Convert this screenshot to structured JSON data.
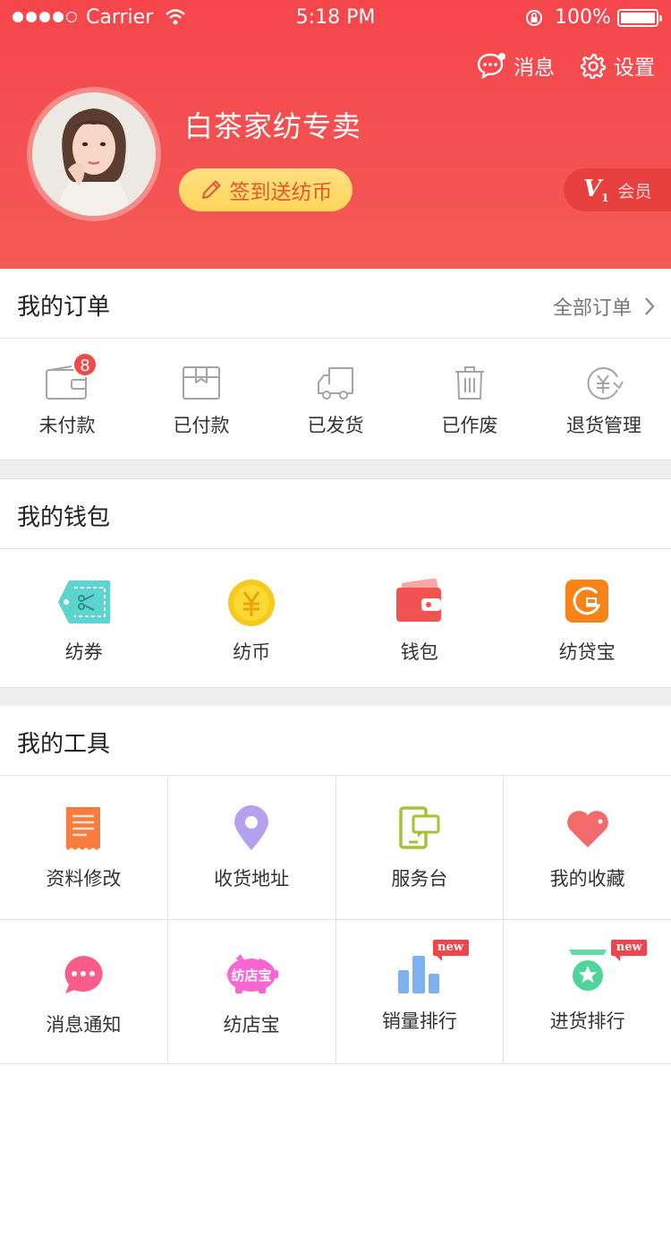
{
  "status_bar": {
    "carrier": "Carrier",
    "time": "5:18 PM",
    "battery": "100%"
  },
  "header": {
    "messages_label": "消息",
    "settings_label": "设置",
    "username": "白茶家纺专卖",
    "signin_label": "签到送纺币",
    "vip_level": "1",
    "vip_label": "会员"
  },
  "orders": {
    "title": "我的订单",
    "all_label": "全部订单",
    "items": [
      {
        "label": "未付款",
        "icon": "wallet-card-icon",
        "badge": "8"
      },
      {
        "label": "已付款",
        "icon": "package-icon"
      },
      {
        "label": "已发货",
        "icon": "truck-icon"
      },
      {
        "label": "已作废",
        "icon": "trash-icon"
      },
      {
        "label": "退货管理",
        "icon": "yen-refund-icon"
      }
    ]
  },
  "wallet": {
    "title": "我的钱包",
    "items": [
      {
        "label": "纺券",
        "icon": "coupon-icon"
      },
      {
        "label": "纺币",
        "icon": "coin-icon"
      },
      {
        "label": "钱包",
        "icon": "wallet-icon"
      },
      {
        "label": "纺贷宝",
        "icon": "loan-icon"
      }
    ]
  },
  "tools": {
    "title": "我的工具",
    "items": [
      {
        "label": "资料修改",
        "icon": "document-icon"
      },
      {
        "label": "收货地址",
        "icon": "location-pin-icon"
      },
      {
        "label": "服务台",
        "icon": "service-desk-icon"
      },
      {
        "label": "我的收藏",
        "icon": "heart-icon"
      },
      {
        "label": "消息通知",
        "icon": "chat-bubble-icon"
      },
      {
        "label": "纺店宝",
        "icon": "piggy-bank-icon",
        "icon_text": "纺店宝"
      },
      {
        "label": "销量排行",
        "icon": "bar-chart-icon",
        "tag": "new"
      },
      {
        "label": "进货排行",
        "icon": "medal-icon",
        "tag": "new"
      }
    ]
  },
  "colors": {
    "brand": "#f5464c",
    "signin_bg": "#ffd55a",
    "badge": "#f04b4b"
  }
}
